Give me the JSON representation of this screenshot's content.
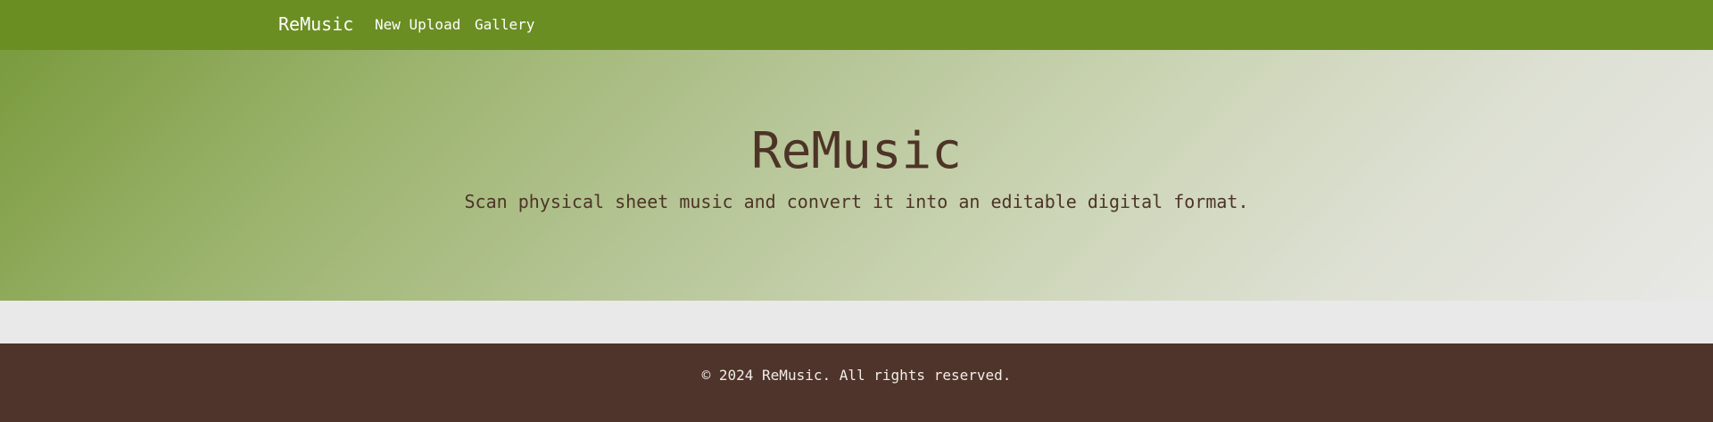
{
  "navbar": {
    "brand": "ReMusic",
    "links": [
      {
        "label": "New Upload"
      },
      {
        "label": "Gallery"
      }
    ]
  },
  "hero": {
    "title": "ReMusic",
    "subtitle": "Scan physical sheet music and convert it into an editable digital format."
  },
  "footer": {
    "copyright": "© 2024 ReMusic. All rights reserved."
  },
  "colors": {
    "navbar_bg": "#6b8e23",
    "hero_text": "#4d3427",
    "footer_bg": "#4e342a",
    "page_bg": "#e9e9e9"
  }
}
